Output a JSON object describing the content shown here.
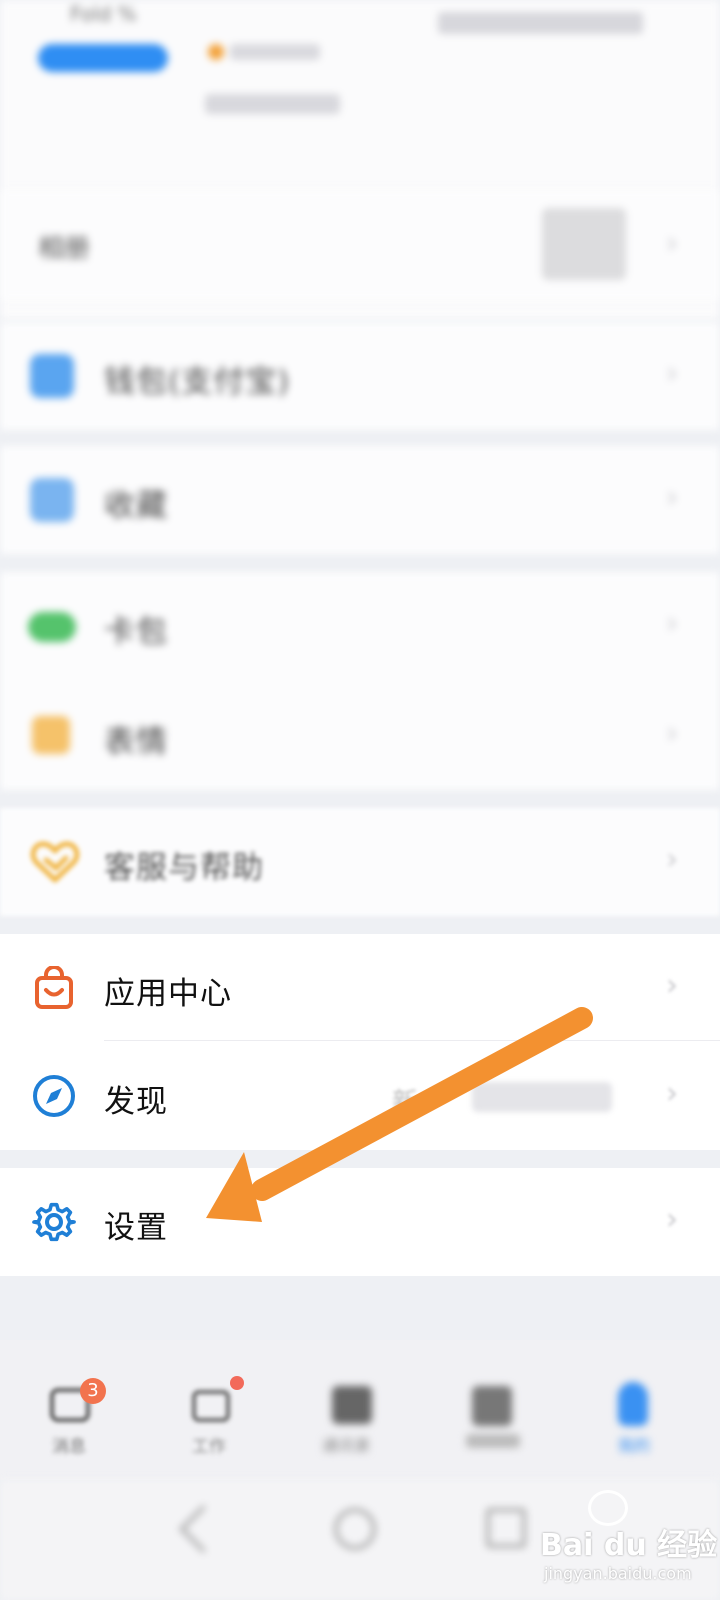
{
  "header": {
    "status_text": "Fold %",
    "account_name": "",
    "level_text": "",
    "status_line": "",
    "status_right": ""
  },
  "profile_row": {
    "label": "相册"
  },
  "menu": {
    "wallet_label": "钱包(支付宝)",
    "favorites_label": "收藏",
    "album_label": "相册",
    "cards_label": "卡包",
    "emoji_label": "表情",
    "service_label": "客服与帮助",
    "app_center_label": "应用中心",
    "discover_label": "发现",
    "discover_hint_new": "新",
    "discover_hint_text": "",
    "settings_label": "设置"
  },
  "tabbar": {
    "messages_label": "消息",
    "messages_badge": "3",
    "work_label": "工作",
    "address_label": "通讯录",
    "tab4_label": "",
    "me_label": "我的"
  },
  "watermark": {
    "brand": "Bai du 经验",
    "url": "jingyan.baidu.com"
  },
  "colors": {
    "accent_blue": "#1f7fd6",
    "app_center_orange": "#e8632f",
    "arrow_orange": "#f39130",
    "badge_red": "#f2734e"
  }
}
